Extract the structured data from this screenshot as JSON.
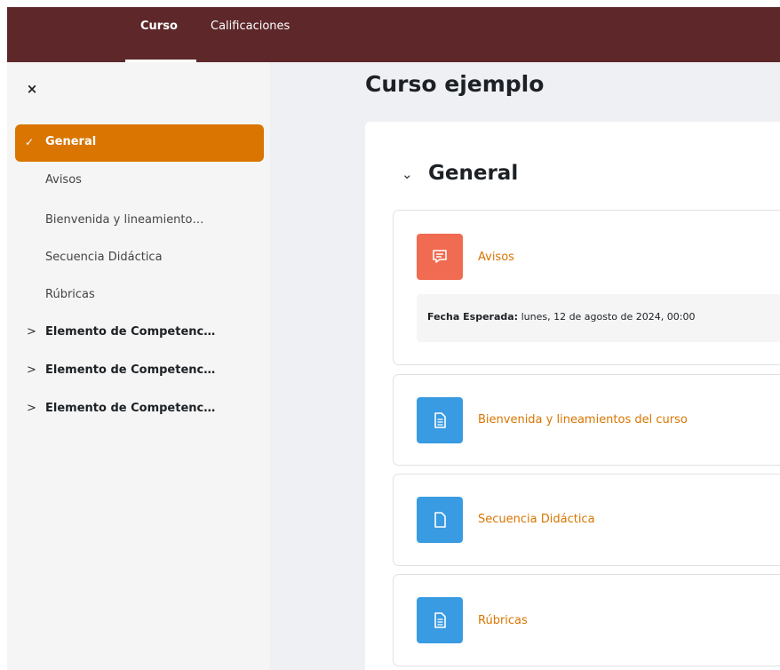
{
  "top_nav": {
    "tabs": [
      {
        "label": "Curso",
        "active": true
      },
      {
        "label": "Calificaciones",
        "active": false
      }
    ]
  },
  "drawer": {
    "close_icon": "×",
    "items": [
      {
        "label": "General",
        "type": "section",
        "expanded": true,
        "active": true
      },
      {
        "label": "Avisos",
        "type": "activity"
      },
      {
        "label": "Bienvenida y lineamiento…",
        "type": "activity"
      },
      {
        "label": "Secuencia Didáctica",
        "type": "activity"
      },
      {
        "label": "Rúbricas",
        "type": "activity"
      },
      {
        "label": "Elemento de Competenc…",
        "type": "section",
        "expanded": false
      },
      {
        "label": "Elemento de Competenc…",
        "type": "section",
        "expanded": false
      },
      {
        "label": "Elemento de Competenc…",
        "type": "section",
        "expanded": false
      }
    ]
  },
  "page": {
    "title": "Curso ejemplo",
    "section": {
      "title": "General",
      "activities": [
        {
          "name": "Avisos",
          "icon": "forum-icon",
          "icon_color": "#f06b51",
          "dates": {
            "label": "Fecha Esperada:",
            "value": "lunes, 12 de agosto de 2024, 00:00"
          }
        },
        {
          "name": "Bienvenida y lineamientos del curso",
          "icon": "page-icon",
          "icon_color": "#399be2"
        },
        {
          "name": "Secuencia Didáctica",
          "icon": "file-icon",
          "icon_color": "#399be2"
        },
        {
          "name": "Rúbricas",
          "icon": "page-icon",
          "icon_color": "#399be2"
        }
      ]
    }
  },
  "colors": {
    "header_bg": "#5e282a",
    "accent": "#d97500",
    "drawer_bg": "#f5f5f5",
    "content_bg": "#eef0f3"
  }
}
